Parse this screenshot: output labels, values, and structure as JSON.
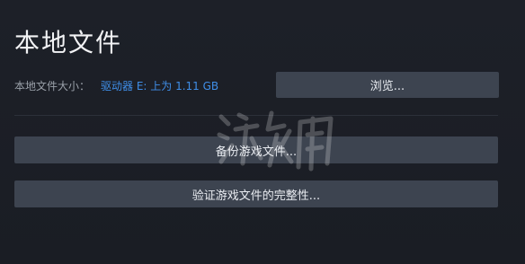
{
  "header": {
    "title": "本地文件"
  },
  "local_files": {
    "size_label": "本地文件大小：",
    "size_value": "驱动器 E: 上为 1.11 GB",
    "browse_label": "浏览..."
  },
  "actions": {
    "backup_label": "备份游戏文件...",
    "verify_label": "验证游戏文件的完整性..."
  },
  "colors": {
    "background": "#1b1e25",
    "button": "#3d4450",
    "link_blue": "#3f8ee8"
  }
}
